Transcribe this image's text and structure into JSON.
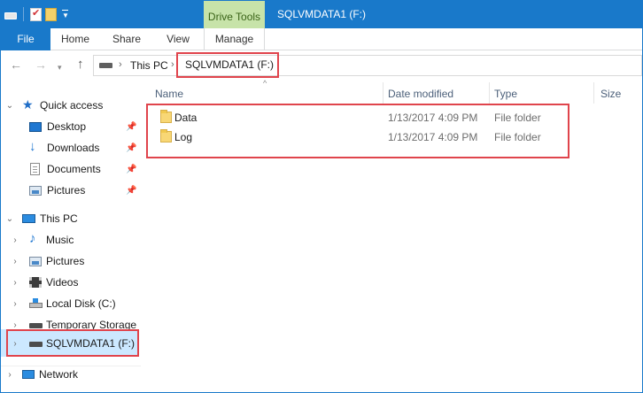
{
  "window": {
    "title": "SQLVMDATA1 (F:)",
    "contextual_tab_group": "Drive Tools"
  },
  "ribbon": {
    "tabs": [
      "File",
      "Home",
      "Share",
      "View",
      "Manage"
    ]
  },
  "address": {
    "segments": [
      "This PC",
      "SQLVMDATA1 (F:)"
    ]
  },
  "navpane": {
    "quick_access": {
      "label": "Quick access",
      "items": [
        {
          "label": "Desktop",
          "icon": "desktop-icon",
          "pinned": true
        },
        {
          "label": "Downloads",
          "icon": "downloads-icon",
          "pinned": true
        },
        {
          "label": "Documents",
          "icon": "documents-icon",
          "pinned": true
        },
        {
          "label": "Pictures",
          "icon": "pictures-icon",
          "pinned": true
        }
      ]
    },
    "this_pc": {
      "label": "This PC",
      "items": [
        {
          "label": "Music",
          "icon": "music-icon"
        },
        {
          "label": "Pictures",
          "icon": "pictures-icon"
        },
        {
          "label": "Videos",
          "icon": "videos-icon"
        },
        {
          "label": "Local Disk (C:)",
          "icon": "local-disk-icon"
        },
        {
          "label": "Temporary Storage",
          "icon": "drive-icon"
        },
        {
          "label": "SQLVMDATA1 (F:)",
          "icon": "drive-icon",
          "selected": true
        }
      ]
    },
    "network": {
      "label": "Network",
      "icon": "network-icon"
    }
  },
  "content": {
    "columns": [
      "Name",
      "Date modified",
      "Type",
      "Size"
    ],
    "rows": [
      {
        "name": "Data",
        "date": "1/13/2017 4:09 PM",
        "type": "File folder"
      },
      {
        "name": "Log",
        "date": "1/13/2017 4:09 PM",
        "type": "File folder"
      }
    ]
  },
  "colors": {
    "accent": "#1979ca",
    "drive_tools_tab": "#c7e3a9",
    "selection": "#cce8ff",
    "highlight_box": "#e0444c"
  }
}
